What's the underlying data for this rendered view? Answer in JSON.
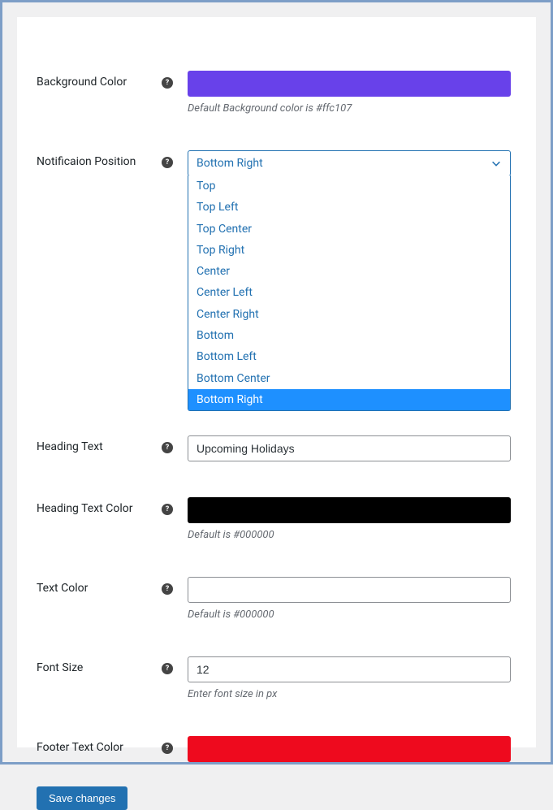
{
  "background_color": {
    "label": "Background Color",
    "hint": "Default Background color is #ffc107",
    "value": "#6841ea"
  },
  "notification_position": {
    "label": "Notificaion Position",
    "selected": "Bottom Right",
    "options": [
      "Top",
      "Top Left",
      "Top Center",
      "Top Right",
      "Center",
      "Center Left",
      "Center Right",
      "Bottom",
      "Bottom Left",
      "Bottom Center",
      "Bottom Right"
    ]
  },
  "heading_text": {
    "label": "Heading Text",
    "value": "Upcoming Holidays"
  },
  "heading_text_color": {
    "label": "Heading Text Color",
    "hint": "Default is #000000",
    "value": "#000000"
  },
  "text_color": {
    "label": "Text Color",
    "hint": "Default is #000000",
    "value": "#ffffff"
  },
  "font_size": {
    "label": "Font Size",
    "value": "12",
    "hint": "Enter font size in px"
  },
  "footer_text_color": {
    "label": "Footer Text Color",
    "value": "#ee0a1e"
  },
  "save_button": "Save changes"
}
